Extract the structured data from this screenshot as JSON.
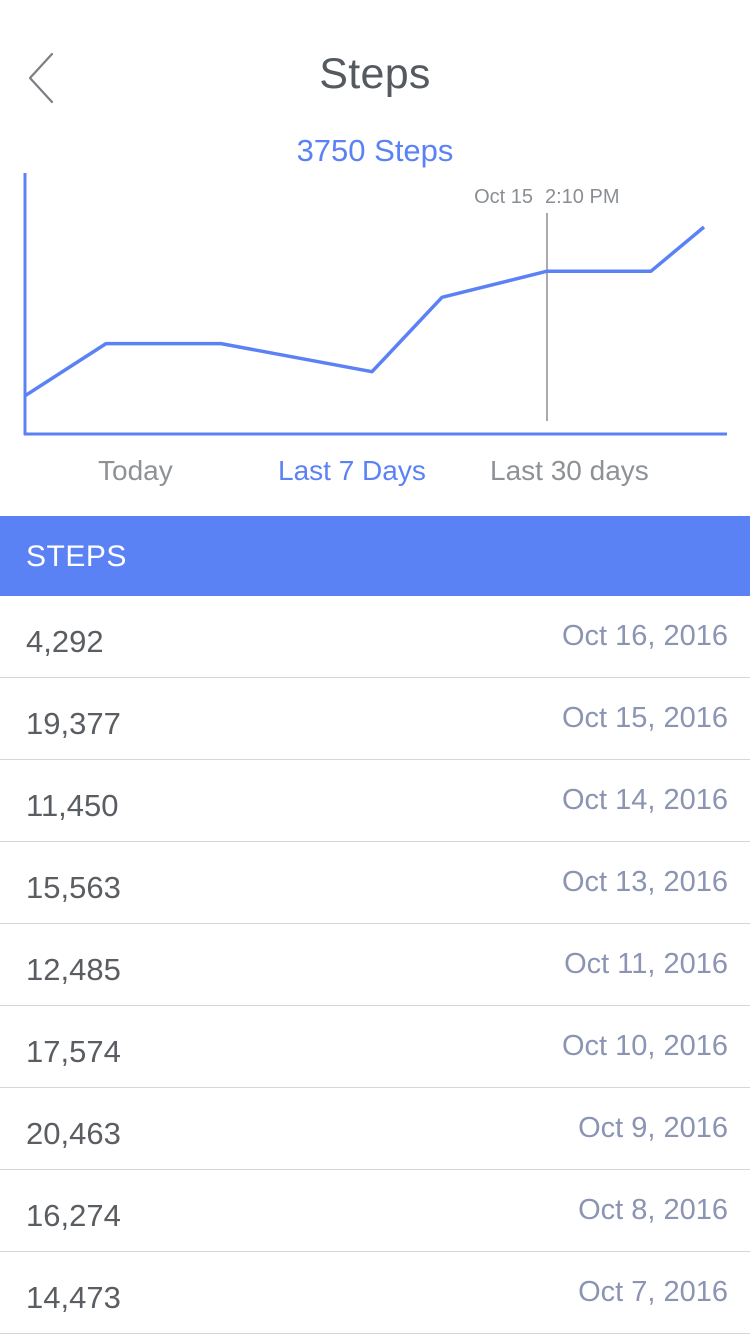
{
  "header": {
    "title": "Steps",
    "back_icon": "chevron-left-icon"
  },
  "summary": {
    "text": "3750 Steps"
  },
  "chart_data": {
    "type": "line",
    "title": "",
    "xlabel": "",
    "ylabel": "",
    "grid": false,
    "marker": {
      "date_label": "Oct 15",
      "time_label": "2:10 PM"
    },
    "series": [
      {
        "values": [
          0.16,
          0.42,
          0.42,
          0.28,
          0.65,
          0.78,
          0.78,
          1.0
        ]
      }
    ],
    "colors": {
      "line": "#5b82f5",
      "axis": "#5b82f5",
      "marker": "#8a8e94"
    }
  },
  "range_tabs": [
    {
      "label": "Today",
      "active": false
    },
    {
      "label": "Last 7 Days",
      "active": true
    },
    {
      "label": "Last 30 days",
      "active": false
    }
  ],
  "section": {
    "label": "STEPS"
  },
  "rows": [
    {
      "steps": "4,292",
      "date": "Oct 16, 2016"
    },
    {
      "steps": "19,377",
      "date": "Oct 15, 2016"
    },
    {
      "steps": "11,450",
      "date": "Oct 14, 2016"
    },
    {
      "steps": "15,563",
      "date": "Oct 13, 2016"
    },
    {
      "steps": "12,485",
      "date": "Oct 11, 2016"
    },
    {
      "steps": "17,574",
      "date": "Oct 10, 2016"
    },
    {
      "steps": "20,463",
      "date": "Oct 9, 2016"
    },
    {
      "steps": "16,274",
      "date": "Oct 8, 2016"
    },
    {
      "steps": "14,473",
      "date": "Oct 7, 2016"
    }
  ],
  "colors": {
    "accent": "#5b82f5",
    "title_text": "#555a60",
    "date_text": "#8b95b3",
    "divider": "#d6d6d6"
  }
}
